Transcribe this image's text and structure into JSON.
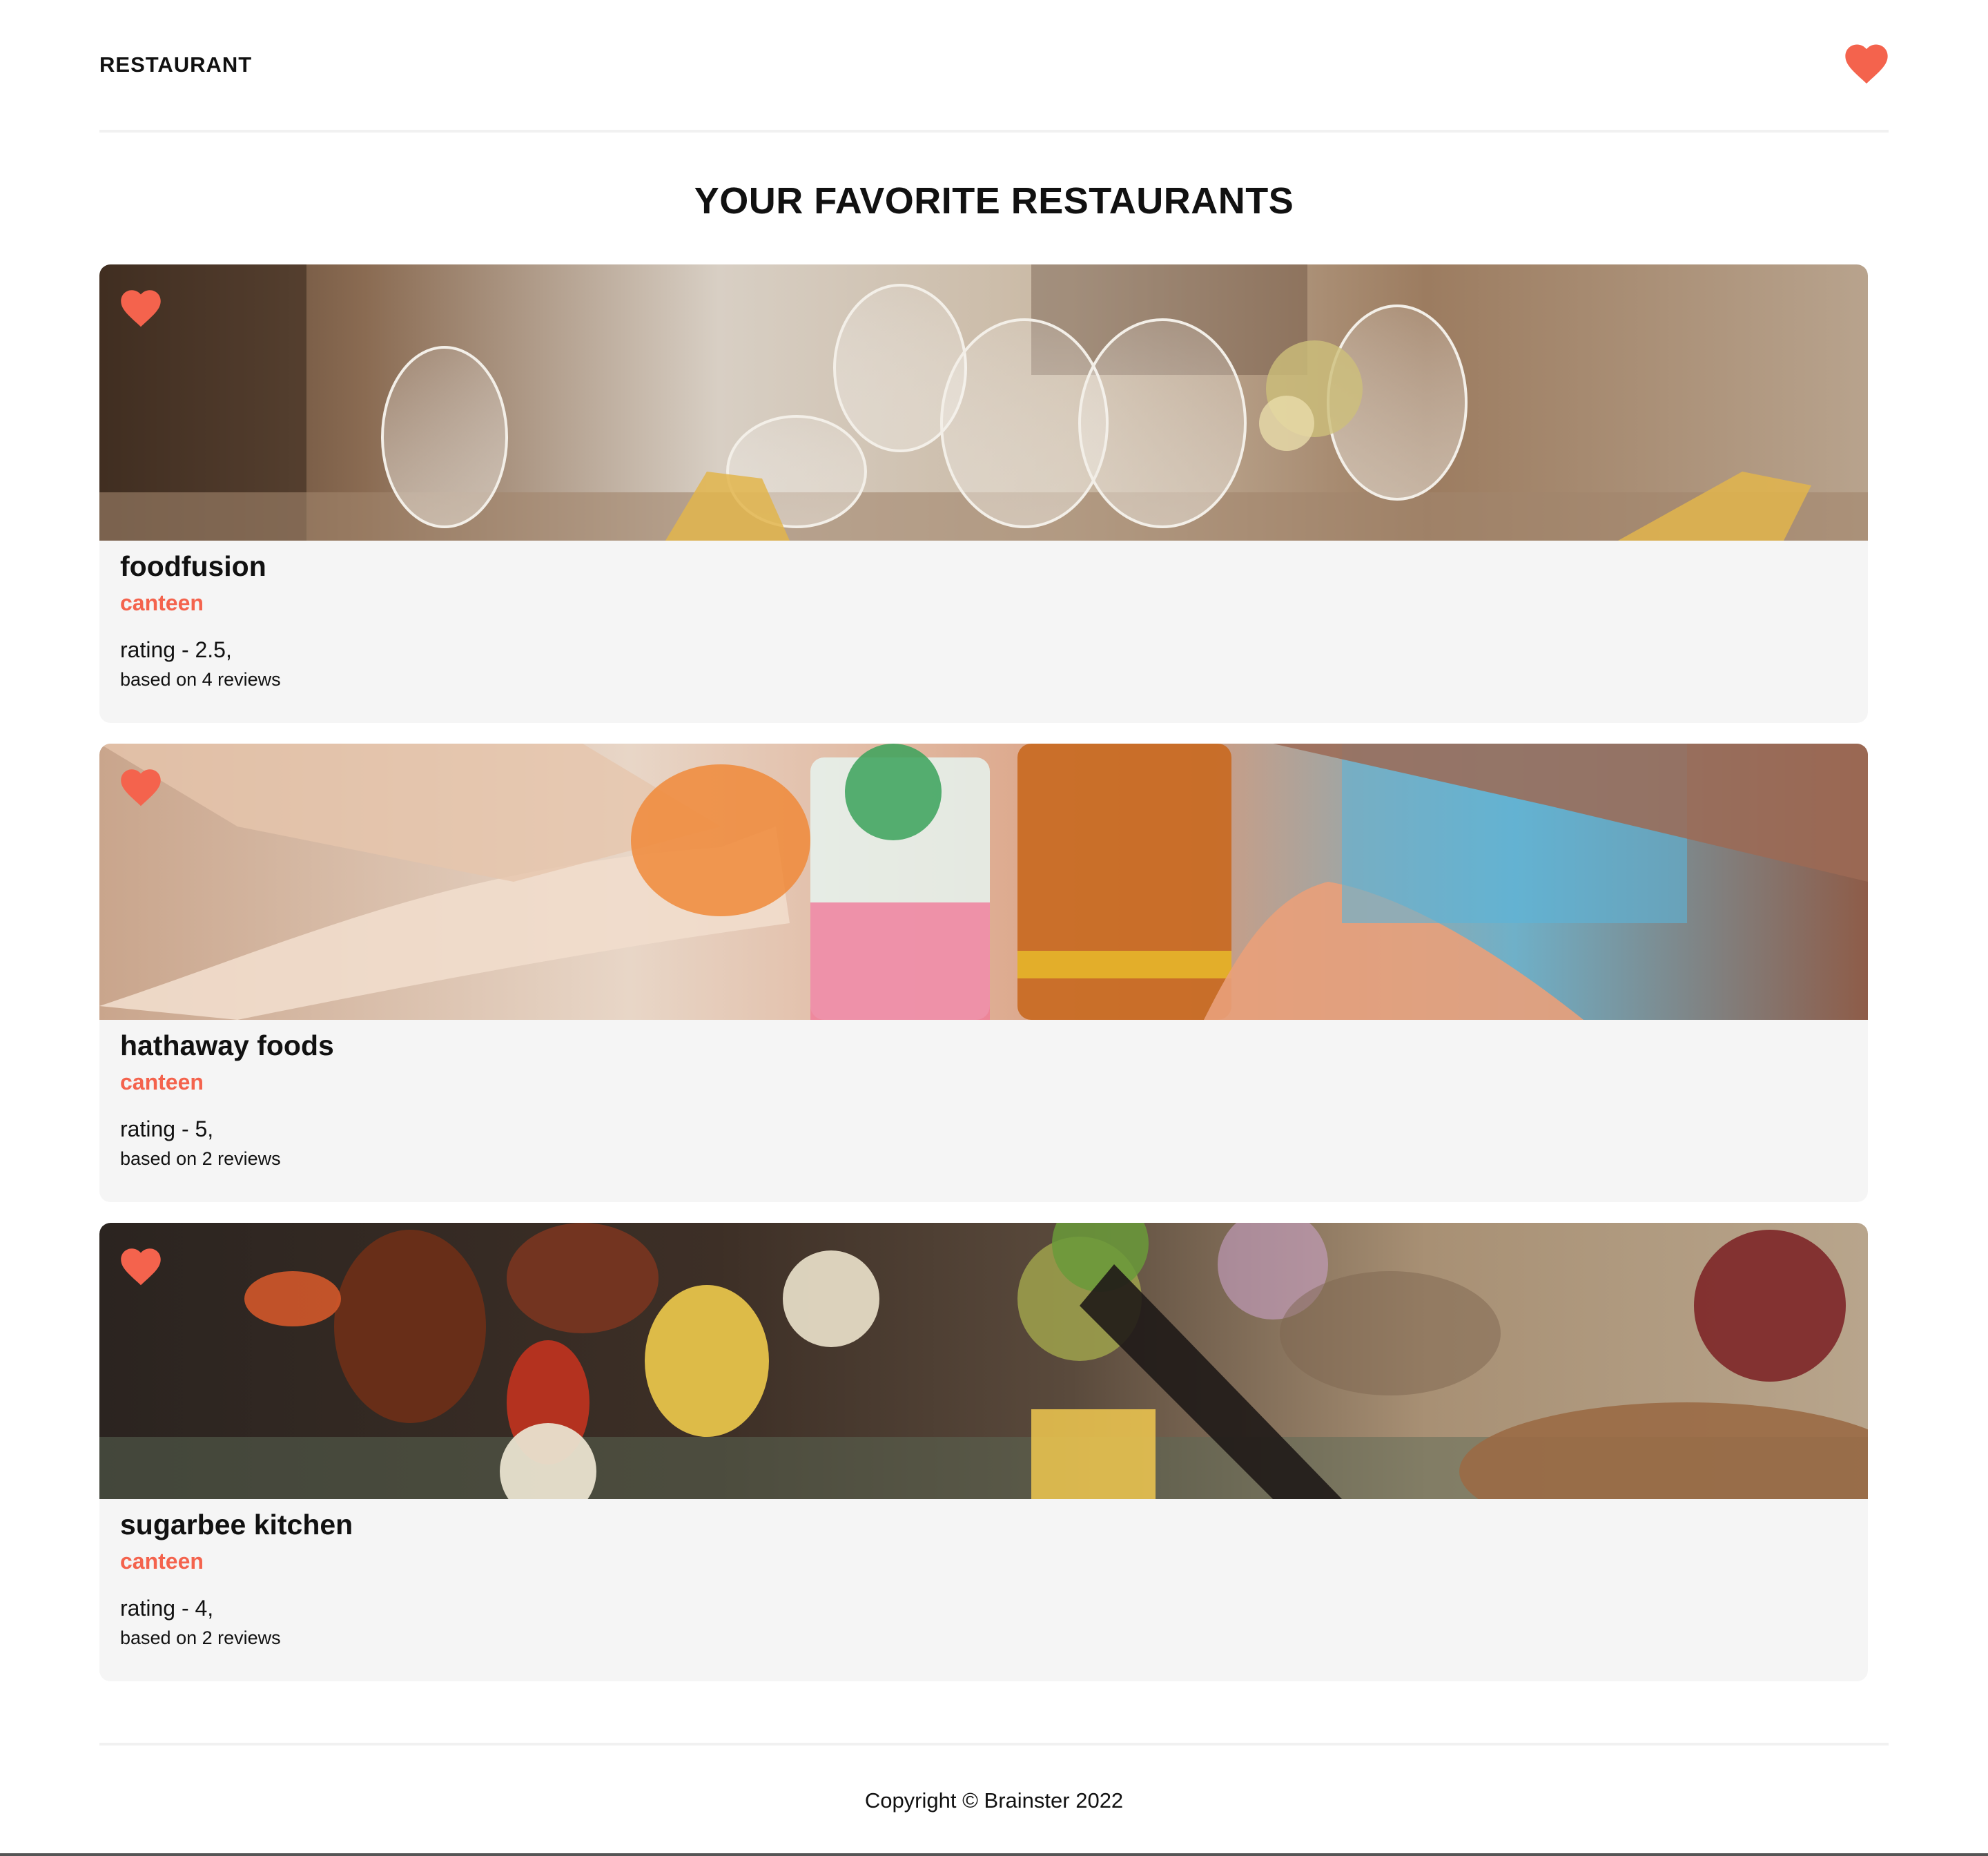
{
  "header": {
    "brand": "RESTAURANT",
    "favorites_icon": "heart-icon"
  },
  "main": {
    "title": "YOUR FAVORITE RESTAURANTS",
    "restaurants": [
      {
        "name": "foodfusion",
        "type": "canteen",
        "rating": "rating - 2.5,",
        "reviews": "based on 4 reviews",
        "favorite_icon": "heart-icon",
        "image": "wine-glasses-table-photo"
      },
      {
        "name": "hathaway foods",
        "type": "canteen",
        "rating": "rating - 5,",
        "reviews": "based on 2 reviews",
        "favorite_icon": "heart-icon",
        "image": "cocktails-toast-photo"
      },
      {
        "name": "sugarbee kitchen",
        "type": "canteen",
        "rating": "rating - 4,",
        "reviews": "based on 2 reviews",
        "favorite_icon": "heart-icon",
        "image": "grilled-food-table-photo"
      }
    ]
  },
  "footer": {
    "copyright": "Copyright © Brainster 2022"
  },
  "colors": {
    "accent": "#F4634D",
    "card_background": "#F5F5F5",
    "text": "#111111"
  }
}
